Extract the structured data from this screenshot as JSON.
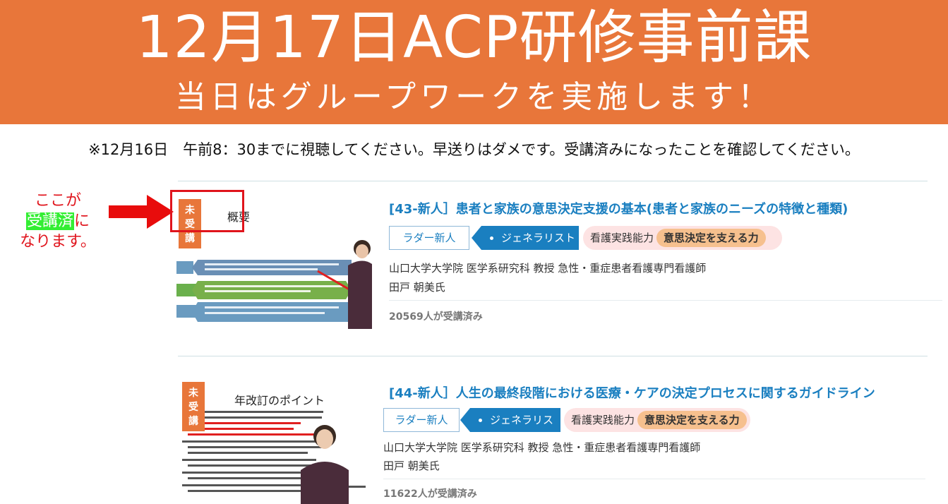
{
  "banner": {
    "title": "12月17日ACP研修事前課",
    "subtitle": "当日はグループワークを実施します！"
  },
  "notice": "※12月16日　午前8：30までに視聴してください。早送りはダメです。受講済みになったことを確認してください。",
  "annotation": {
    "line1": "ここが",
    "highlight": "受講済",
    "line2_suffix": "に",
    "line3": "なります。"
  },
  "courses": [
    {
      "status": "未受講",
      "slide_title": "概要",
      "title": "[43-新人］患者と家族の意思決定支援の基本(患者と家族のニーズの特徴と種類)",
      "tag_ladder": "ラダー新人",
      "tag_generalist": "ジェネラリスト",
      "skill_label": "看護実践能力",
      "skill_value": "意思決定を支える力",
      "lecturer_affiliation": "山口大学大学院 医学系研究科 教授 急性・重症患者看護専門看護師",
      "lecturer_name": "田戸 朝美氏",
      "count": "20569人が受講済み"
    },
    {
      "status": "未受講",
      "slide_title": "年改訂のポイント",
      "title": "[44-新人］人生の最終段階における医療・ケアの決定プロセスに関するガイドライン",
      "tag_ladder": "ラダー新人",
      "tag_generalist": "ジェネラリスト",
      "skill_label": "看護実践能力",
      "skill_value": "意思決定を支える力",
      "lecturer_affiliation": "山口大学大学院 医学系研究科 教授 急性・重症患者看護専門看護師",
      "lecturer_name": "田戸 朝美氏",
      "count": "11622人が受講済み"
    }
  ],
  "colors": {
    "banner": "#e8763a",
    "link": "#1a7fc0",
    "annotation": "#e0141c",
    "highlight": "#33ee33"
  }
}
